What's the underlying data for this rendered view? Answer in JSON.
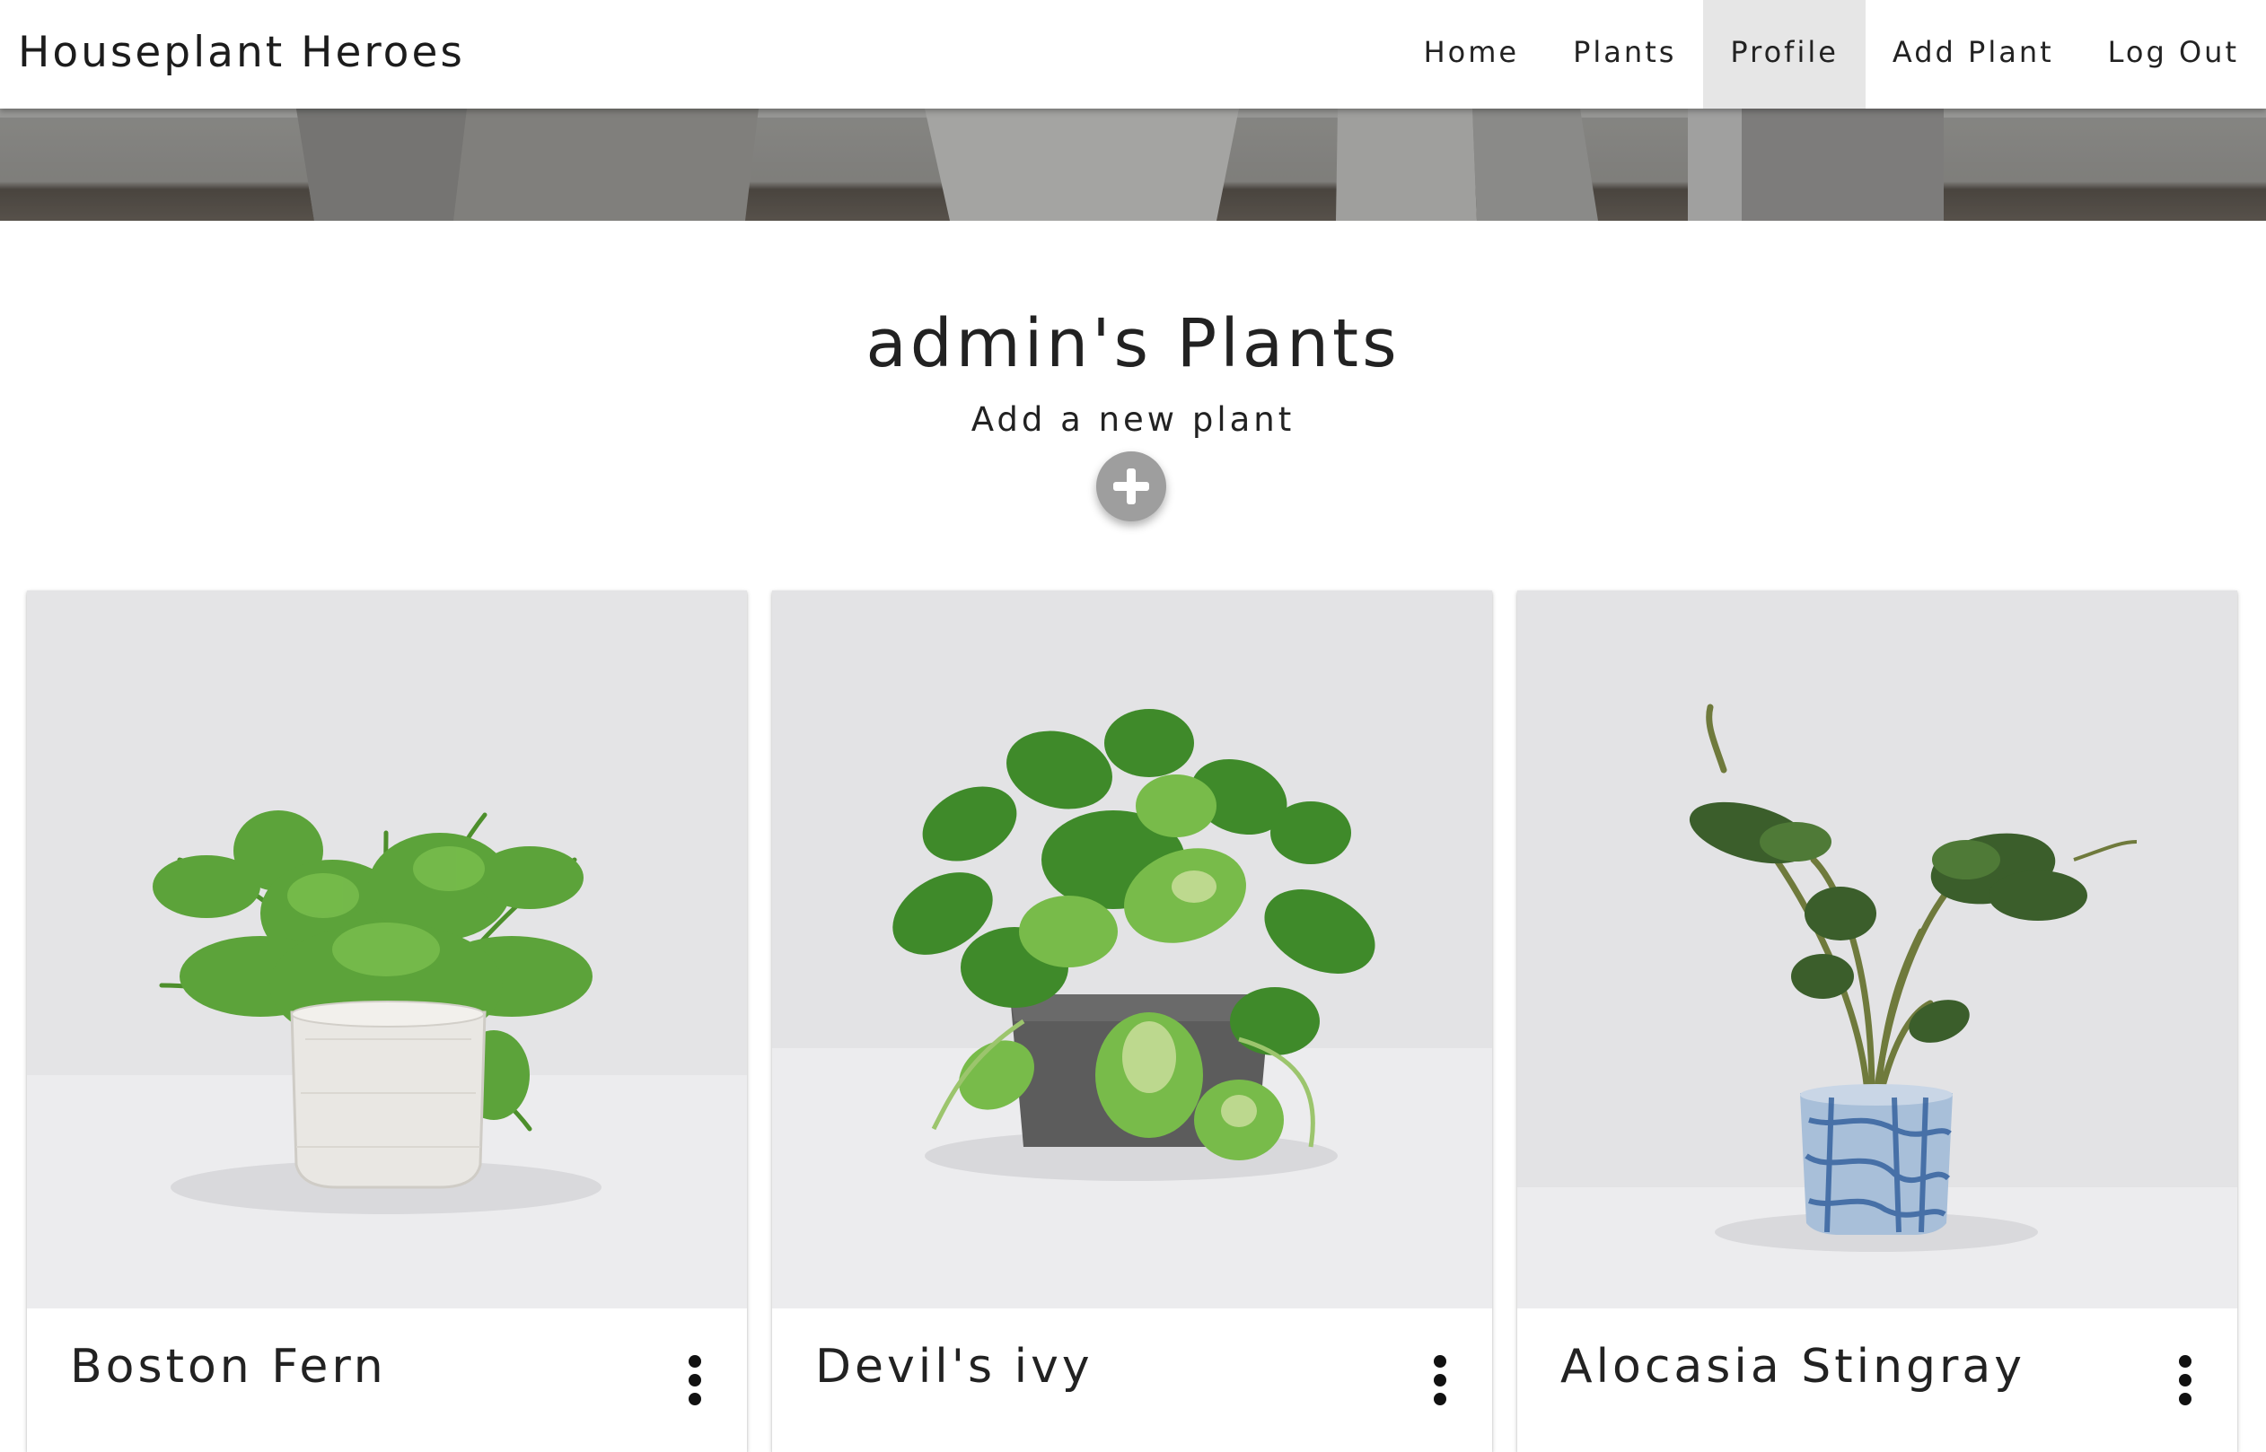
{
  "brand": "Houseplant Heroes",
  "nav": [
    {
      "label": "Home",
      "active": false
    },
    {
      "label": "Plants",
      "active": false
    },
    {
      "label": "Profile",
      "active": true
    },
    {
      "label": "Add Plant",
      "active": false
    },
    {
      "label": "Log Out",
      "active": false
    }
  ],
  "page": {
    "title": "admin's Plants",
    "add_caption": "Add a new plant",
    "add_icon": "plus-icon"
  },
  "cards": [
    {
      "title": "Boston Fern",
      "menu_icon": "more-vert-icon"
    },
    {
      "title": "Devil's ivy",
      "menu_icon": "more-vert-icon"
    },
    {
      "title": "Alocasia Stingray",
      "menu_icon": "more-vert-icon"
    }
  ],
  "colors": {
    "active_nav_bg": "#e6e6e6",
    "fab_bg": "#9e9e9e",
    "card_image_bg": "#e4e4e6"
  }
}
